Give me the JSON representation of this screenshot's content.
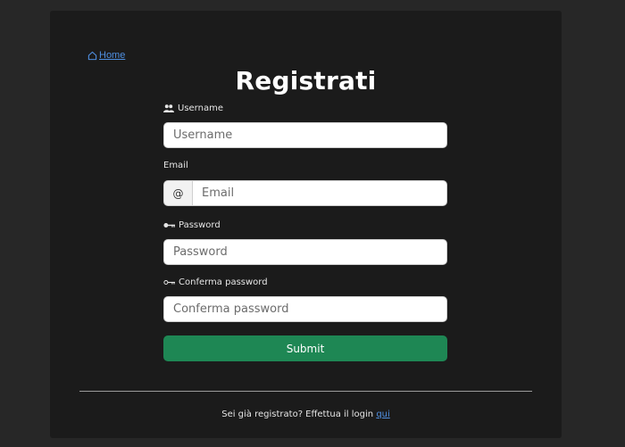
{
  "nav": {
    "home_label": "Home",
    "home_icon": "home-icon"
  },
  "page": {
    "title": "Registrati"
  },
  "form": {
    "username": {
      "label": "Username",
      "icon": "users-icon",
      "placeholder": "Username",
      "value": ""
    },
    "email": {
      "label": "Email",
      "addon": "@",
      "placeholder": "Email",
      "value": ""
    },
    "password": {
      "label": "Password",
      "icon": "key-icon",
      "placeholder": "Password",
      "value": ""
    },
    "confirm_password": {
      "label": "Conferma password",
      "icon": "key-outline-icon",
      "placeholder": "Conferma password",
      "value": ""
    },
    "submit_label": "Submit"
  },
  "footer": {
    "text": "Sei già registrato? Effettua il login",
    "link_label": "qui"
  },
  "colors": {
    "background": "#272727",
    "panel": "#1b1b1b",
    "accent_link": "#4f8fe0",
    "submit_button": "#1e8754"
  }
}
